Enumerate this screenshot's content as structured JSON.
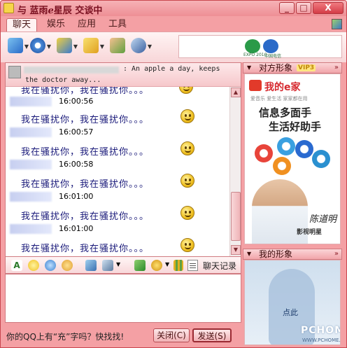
{
  "window": {
    "title": "与 蓝雨ℯ星辰 交谈中",
    "min_label": "_",
    "max_label": "□",
    "close_label": "X"
  },
  "tabs": [
    "聊天",
    "娱乐",
    "应用",
    "工具"
  ],
  "top_ad": {
    "caption1": "EXPO 2010",
    "caption2": "中国电信"
  },
  "contact": {
    "signature_line1": ": An apple a day, keeps",
    "signature_line2": "the doctor away..."
  },
  "messages": [
    {
      "time": "16:00:56",
      "text": "我在骚扰你。。。"
    },
    {
      "time": "16:00:57",
      "text": "我在骚扰你，我在骚扰你。。。"
    },
    {
      "time": "16:00:58",
      "text": "我在骚扰你，我在骚扰你。。。"
    },
    {
      "time": "16:01:00",
      "text": "我在骚扰你，我在骚扰你。。。"
    },
    {
      "time": "16:01:00",
      "text": "我在骚扰你，我在骚扰你。。。"
    },
    {
      "time": "",
      "text": "我在骚扰你，我在骚扰你。。。"
    }
  ],
  "first_partial_text": "我在骚扰你，我在骚扰你。。。",
  "input_toolbar": {
    "history_label": "聊天记录"
  },
  "bottom": {
    "promo": "你的QQ上有“充”字吗？快找找!",
    "close_btn": "关闭(C)",
    "send_btn": "发送(S)"
  },
  "right_panel": {
    "peer_image_title": "对方形象",
    "vip_badge": "VIP3",
    "my_image_title": "我的形象",
    "more": "»"
  },
  "side_ad": {
    "brand": "我的e家",
    "tagline": "爱音乐 爱生活 家家都在用",
    "line1": "信息多面手",
    "line2": "生活好助手",
    "star": "影视明星",
    "signature": "陈道明"
  },
  "my_image": {
    "label": "点此",
    "watermark": "PCHOME",
    "watermark2": "WWW.PCHOME.NET"
  },
  "colors": {
    "accent": "#ee8f95",
    "border": "#d07a80",
    "message_text": "#1a1a7a"
  }
}
